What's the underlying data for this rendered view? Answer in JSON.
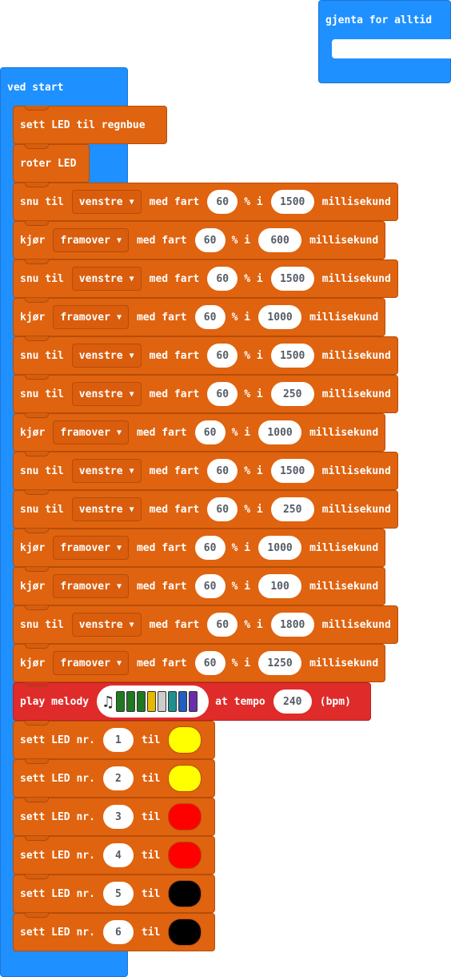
{
  "forever": {
    "label": "gjenta for alltid"
  },
  "start": {
    "label": "ved start"
  },
  "blocks": {
    "b1": {
      "text": "sett LED til regnbue"
    },
    "b2": {
      "text": "roter LED"
    },
    "r3": {
      "verb": "snu til",
      "dir": "venstre",
      "speed_label": "med fart",
      "speed": "60",
      "pct": "% i",
      "ms": "1500",
      "unit": "millisekund"
    },
    "r4": {
      "verb": "kjør",
      "dir": "framover",
      "speed_label": "med fart",
      "speed": "60",
      "pct": "% i",
      "ms": "600",
      "unit": "millisekund"
    },
    "r5": {
      "verb": "snu til",
      "dir": "venstre",
      "speed_label": "med fart",
      "speed": "60",
      "pct": "% i",
      "ms": "1500",
      "unit": "millisekund"
    },
    "r6": {
      "verb": "kjør",
      "dir": "framover",
      "speed_label": "med fart",
      "speed": "60",
      "pct": "% i",
      "ms": "1000",
      "unit": "millisekund"
    },
    "r7": {
      "verb": "snu til",
      "dir": "venstre",
      "speed_label": "med fart",
      "speed": "60",
      "pct": "% i",
      "ms": "1500",
      "unit": "millisekund"
    },
    "r8": {
      "verb": "snu til",
      "dir": "venstre",
      "speed_label": "med fart",
      "speed": "60",
      "pct": "% i",
      "ms": "250",
      "unit": "millisekund"
    },
    "r9": {
      "verb": "kjør",
      "dir": "framover",
      "speed_label": "med fart",
      "speed": "60",
      "pct": "% i",
      "ms": "1000",
      "unit": "millisekund"
    },
    "r10": {
      "verb": "snu til",
      "dir": "venstre",
      "speed_label": "med fart",
      "speed": "60",
      "pct": "% i",
      "ms": "1500",
      "unit": "millisekund"
    },
    "r11": {
      "verb": "snu til",
      "dir": "venstre",
      "speed_label": "med fart",
      "speed": "60",
      "pct": "% i",
      "ms": "250",
      "unit": "millisekund"
    },
    "r12": {
      "verb": "kjør",
      "dir": "framover",
      "speed_label": "med fart",
      "speed": "60",
      "pct": "% i",
      "ms": "1000",
      "unit": "millisekund"
    },
    "r13": {
      "verb": "kjør",
      "dir": "framover",
      "speed_label": "med fart",
      "speed": "60",
      "pct": "% i",
      "ms": "100",
      "unit": "millisekund"
    },
    "r14": {
      "verb": "snu til",
      "dir": "venstre",
      "speed_label": "med fart",
      "speed": "60",
      "pct": "% i",
      "ms": "1800",
      "unit": "millisekund"
    },
    "r15": {
      "verb": "kjør",
      "dir": "framover",
      "speed_label": "med fart",
      "speed": "60",
      "pct": "% i",
      "ms": "1250",
      "unit": "millisekund"
    },
    "melody": {
      "play_label": "play melody",
      "tempo_label": "at tempo",
      "tempo": "240",
      "bpm_label": "(bpm)",
      "note_icon": "music-note-icon",
      "note_colors": [
        "#1f7a1f",
        "#1f7a1f",
        "#1f7a1f",
        "#e6b800",
        "#cccccc",
        "#1f8f8f",
        "#1f5fbf",
        "#6a2fa8"
      ]
    },
    "leds": [
      {
        "label": "sett LED nr.",
        "n": "1",
        "til": "til",
        "color": "#ffff00"
      },
      {
        "label": "sett LED nr.",
        "n": "2",
        "til": "til",
        "color": "#ffff00"
      },
      {
        "label": "sett LED nr.",
        "n": "3",
        "til": "til",
        "color": "#ff0000"
      },
      {
        "label": "sett LED nr.",
        "n": "4",
        "til": "til",
        "color": "#ff0000"
      },
      {
        "label": "sett LED nr.",
        "n": "5",
        "til": "til",
        "color": "#000000"
      },
      {
        "label": "sett LED nr.",
        "n": "6",
        "til": "til",
        "color": "#000000"
      }
    ]
  }
}
